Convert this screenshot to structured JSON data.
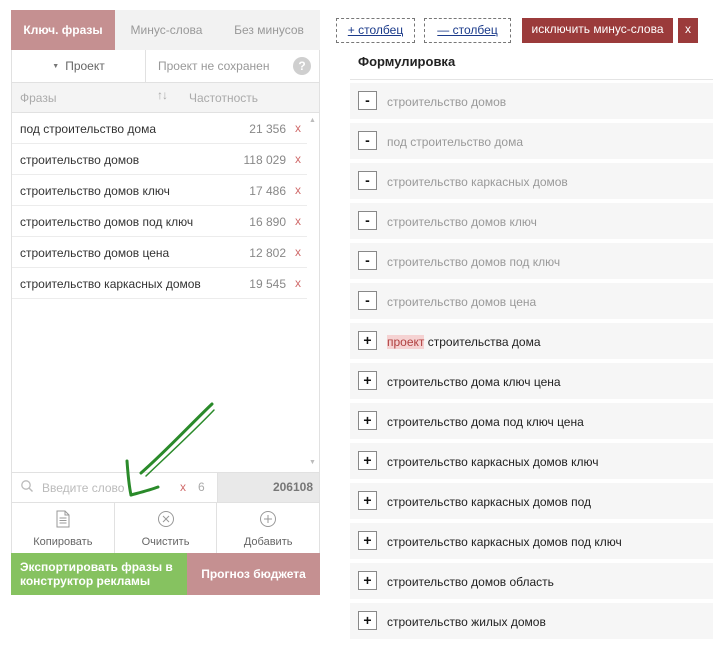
{
  "tabs": [
    {
      "label": "Ключ. фразы",
      "active": true
    },
    {
      "label": "Минус-слова",
      "active": false
    },
    {
      "label": "Без минусов",
      "active": false
    }
  ],
  "project": {
    "select_label": "Проект",
    "status": "Проект не сохранен",
    "help": "?"
  },
  "columns": {
    "phrases": "Фразы",
    "sort": "↑↓",
    "frequency": "Частотность"
  },
  "phrases": [
    {
      "text": "под строительство дома",
      "freq": "21 356"
    },
    {
      "text": "строительство домов",
      "freq": "118 029"
    },
    {
      "text": "строительство домов ключ",
      "freq": "17 486"
    },
    {
      "text": "строительство домов под ключ",
      "freq": "16 890"
    },
    {
      "text": "строительство домов цена",
      "freq": "12 802"
    },
    {
      "text": "строительство каркасных домов",
      "freq": "19 545"
    }
  ],
  "remove_symbol": "x",
  "search": {
    "placeholder": "Введите слово",
    "clear": "x",
    "count": "6",
    "total": "206108"
  },
  "actions": {
    "copy": "Копировать",
    "clear": "Очистить",
    "add": "Добавить"
  },
  "buttons": {
    "export_line1": "Экспортировать фразы в",
    "export_line2": "конструктор рекламы",
    "budget": "Прогноз бюджета"
  },
  "toolbar": {
    "add_column": "+ столбец",
    "remove_column": "— столбец",
    "exclude": "исключить минус-слова",
    "close": "x"
  },
  "formulation": {
    "header": "Формулировка",
    "highlight_word": "проект",
    "rows": [
      {
        "sign": "-",
        "text": "строительство домов"
      },
      {
        "sign": "-",
        "text": "под строительство дома"
      },
      {
        "sign": "-",
        "text": "строительство каркасных домов"
      },
      {
        "sign": "-",
        "text": "строительство домов ключ"
      },
      {
        "sign": "-",
        "text": "строительство домов под ключ"
      },
      {
        "sign": "-",
        "text": "строительство домов цена"
      },
      {
        "sign": "+",
        "text": "проект строительства дома"
      },
      {
        "sign": "+",
        "text": "строительство дома ключ цена"
      },
      {
        "sign": "+",
        "text": "строительство дома под ключ цена"
      },
      {
        "sign": "+",
        "text": "строительство каркасных домов ключ"
      },
      {
        "sign": "+",
        "text": "строительство каркасных домов под"
      },
      {
        "sign": "+",
        "text": "строительство каркасных домов под ключ"
      },
      {
        "sign": "+",
        "text": "строительство домов область"
      },
      {
        "sign": "+",
        "text": "строительство жилых домов"
      }
    ]
  },
  "colors": {
    "tab_active": "#c59091",
    "export_green": "#86c260",
    "exclude_red": "#9b3b3b",
    "link_blue": "#1a3a8a",
    "remove_red": "#d06b6b",
    "arrow_green": "#2a8a2a"
  }
}
